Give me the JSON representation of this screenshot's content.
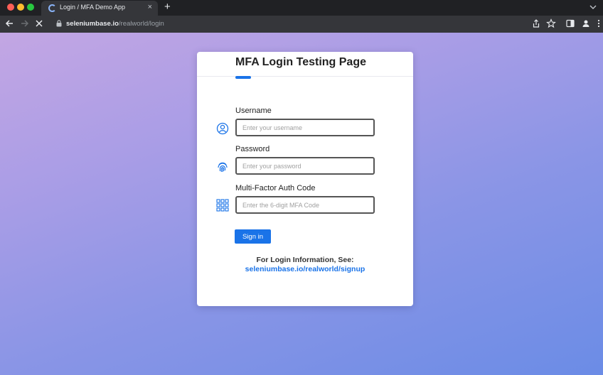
{
  "browser": {
    "tab_title": "Login / MFA Demo App",
    "tab_close": "×",
    "new_tab": "+",
    "url_host": "seleniumbase.io",
    "url_path": "/realworld/login"
  },
  "card": {
    "title": "MFA Login Testing Page",
    "fields": [
      {
        "label": "Username",
        "placeholder": "Enter your username",
        "icon": "user-circle-icon"
      },
      {
        "label": "Password",
        "placeholder": "Enter your password",
        "icon": "fingerprint-icon"
      },
      {
        "label": "Multi-Factor Auth Code",
        "placeholder": "Enter the 6-digit MFA Code",
        "icon": "keypad-grid-icon"
      }
    ],
    "signin_label": "Sign in",
    "info_label": "For Login Information, See:",
    "info_link": "seleniumbase.io/realworld/signup"
  },
  "colors": {
    "accent": "#1a73e8",
    "gradient_start": "#c3a6e3",
    "gradient_end": "#6b8ce6"
  }
}
